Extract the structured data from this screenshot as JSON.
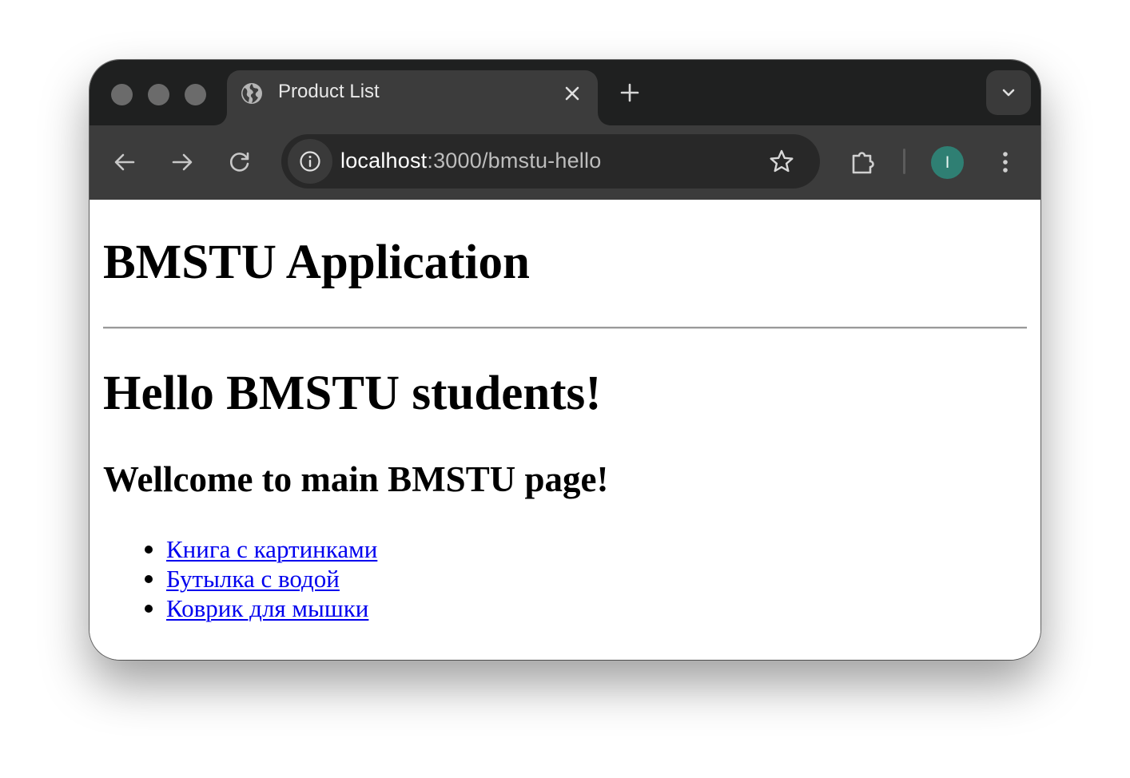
{
  "browser": {
    "tab": {
      "title": "Product List"
    },
    "address_bar": {
      "host": "localhost",
      "path": ":3000/bmstu-hello"
    },
    "profile": {
      "initial": "I",
      "color": "#2f7f73"
    },
    "icons": [
      "globe-icon",
      "close-icon",
      "plus-icon",
      "chevron-down-icon",
      "back-arrow-icon",
      "forward-arrow-icon",
      "reload-icon",
      "site-info-icon",
      "star-icon",
      "extensions-puzzle-icon",
      "kebab-menu-icon"
    ]
  },
  "page": {
    "app_title": "BMSTU Application",
    "greeting": "Hello BMSTU students!",
    "welcome": "Wellcome to main BMSTU page!",
    "links": [
      "Книга с картинками",
      "Бутылка с водой",
      "Коврик для мышки"
    ],
    "link_color": "#0000ee"
  }
}
